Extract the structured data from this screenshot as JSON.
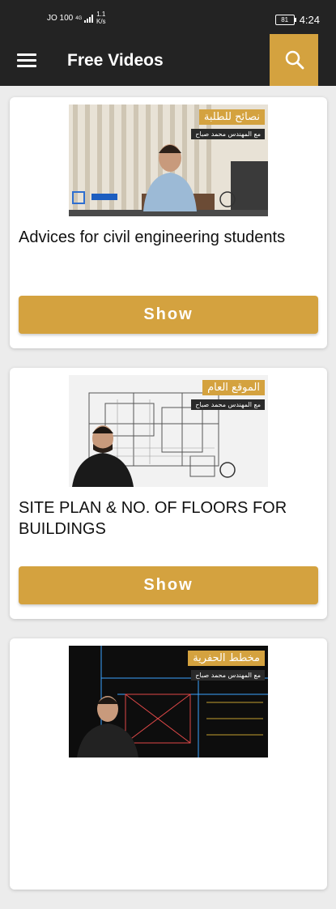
{
  "status_bar": {
    "carrier": "JO 100",
    "signal": "4G",
    "speed_value": "1.1",
    "speed_unit": "K/s",
    "battery": "81",
    "time": "4:24"
  },
  "app_bar": {
    "title": "Free Videos",
    "menu_icon": "hamburger-menu-icon",
    "search_icon": "search-icon"
  },
  "accent_color": "#d4a23f",
  "videos": [
    {
      "title": "Advices for civil engineering students",
      "button": "Show",
      "thumb_title": "نصائح للطلبة",
      "thumb_sub": "مع المهندس محمد صباح"
    },
    {
      "title": "SITE PLAN & NO. OF FLOORS FOR BUILDINGS",
      "button": "Show",
      "thumb_title": "الموقع العام",
      "thumb_sub": "مع المهندس محمد صباح"
    },
    {
      "title": "",
      "button": "",
      "thumb_title": "مخطط الحفرية",
      "thumb_sub": "مع المهندس محمد صباح"
    }
  ]
}
